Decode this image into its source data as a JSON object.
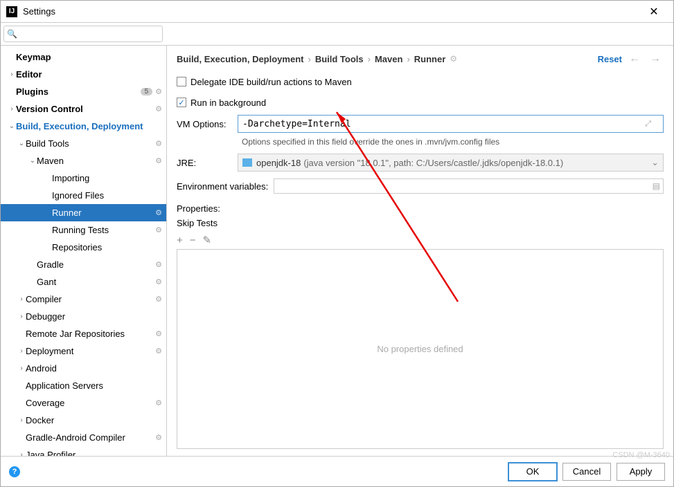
{
  "title": "Settings",
  "search": {
    "placeholder": ""
  },
  "sidebar": [
    {
      "label": "Keymap",
      "depth": 0,
      "bold": true,
      "arrow": ""
    },
    {
      "label": "Editor",
      "depth": 0,
      "bold": true,
      "arrow": "›"
    },
    {
      "label": "Plugins",
      "depth": 0,
      "bold": true,
      "arrow": "",
      "count": "5",
      "gear": true
    },
    {
      "label": "Version Control",
      "depth": 0,
      "bold": true,
      "arrow": "›",
      "gear": true
    },
    {
      "label": "Build, Execution, Deployment",
      "depth": 0,
      "exp": true,
      "arrow": "⌄"
    },
    {
      "label": "Build Tools",
      "depth": 1,
      "arrow": "⌄",
      "gear": true
    },
    {
      "label": "Maven",
      "depth": 2,
      "arrow": "⌄",
      "gear": true
    },
    {
      "label": "Importing",
      "depth": 3,
      "arrow": ""
    },
    {
      "label": "Ignored Files",
      "depth": 3,
      "arrow": ""
    },
    {
      "label": "Runner",
      "depth": 3,
      "arrow": "",
      "selected": true,
      "gear": true
    },
    {
      "label": "Running Tests",
      "depth": 3,
      "arrow": "",
      "gear": true
    },
    {
      "label": "Repositories",
      "depth": 3,
      "arrow": ""
    },
    {
      "label": "Gradle",
      "depth": 2,
      "arrow": "",
      "gear": true
    },
    {
      "label": "Gant",
      "depth": 2,
      "arrow": "",
      "gear": true
    },
    {
      "label": "Compiler",
      "depth": 1,
      "arrow": "›",
      "gear": true
    },
    {
      "label": "Debugger",
      "depth": 1,
      "arrow": "›"
    },
    {
      "label": "Remote Jar Repositories",
      "depth": 1,
      "arrow": "",
      "gear": true
    },
    {
      "label": "Deployment",
      "depth": 1,
      "arrow": "›",
      "gear": true
    },
    {
      "label": "Android",
      "depth": 1,
      "arrow": "›"
    },
    {
      "label": "Application Servers",
      "depth": 1,
      "arrow": ""
    },
    {
      "label": "Coverage",
      "depth": 1,
      "arrow": "",
      "gear": true
    },
    {
      "label": "Docker",
      "depth": 1,
      "arrow": "›"
    },
    {
      "label": "Gradle-Android Compiler",
      "depth": 1,
      "arrow": "",
      "gear": true
    },
    {
      "label": "Java Profiler",
      "depth": 1,
      "arrow": "›"
    }
  ],
  "breadcrumb": [
    "Build, Execution, Deployment",
    "Build Tools",
    "Maven",
    "Runner"
  ],
  "reset_label": "Reset",
  "form": {
    "delegate_label": "Delegate IDE build/run actions to Maven",
    "delegate_checked": false,
    "background_label": "Run in background",
    "background_checked": true,
    "vm_label": "VM Options:",
    "vm_value": "-Darchetype=Internal",
    "vm_hint": "Options specified in this field override the ones in .mvn/jvm.config files",
    "jre_label": "JRE:",
    "jre_main": "openjdk-18",
    "jre_detail": "(java version \"18.0.1\", path: C:/Users/castle/.jdks/openjdk-18.0.1)",
    "env_label": "Environment variables:",
    "props_label": "Properties:",
    "skip_label": "Skip Tests",
    "skip_checked": false,
    "no_props": "No properties defined"
  },
  "footer": {
    "ok": "OK",
    "cancel": "Cancel",
    "apply": "Apply"
  },
  "watermark": "CSDN @M-3640"
}
